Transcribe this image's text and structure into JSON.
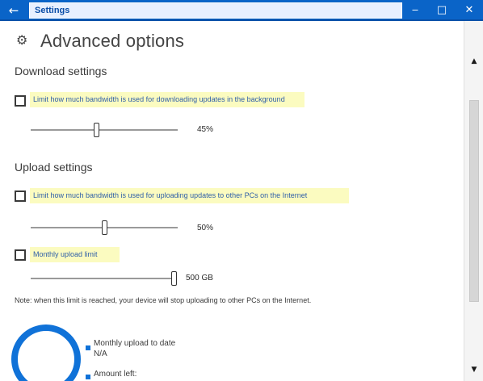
{
  "window": {
    "title": "Settings",
    "back_glyph": "←",
    "minimize_glyph": "‒",
    "maximize_glyph": "□",
    "close_glyph": "✕"
  },
  "page": {
    "title": "Advanced options",
    "icon": "gear-icon"
  },
  "download": {
    "heading": "Download settings",
    "limit_label": "Limit how much bandwidth is used for downloading updates in the background",
    "limit_checked": false,
    "slider_percent": 45,
    "slider_value": "45%"
  },
  "upload": {
    "heading": "Upload settings",
    "limit_label": "Limit how much bandwidth is used for uploading updates to other PCs on the Internet",
    "limit_checked": false,
    "slider_percent": 50,
    "slider_value": "50%",
    "monthly_label": "Monthly upload limit",
    "monthly_checked": false,
    "monthly_slider_value": "500 GB",
    "note": "Note: when this limit is reached, your device will stop uploading to other PCs on the Internet."
  },
  "stats": {
    "upload_to_date_label": "Monthly upload to date",
    "upload_to_date_value": "N/A",
    "amount_left_label": "Amount left:"
  },
  "colors": {
    "title_bar": "#0a64c8",
    "accent": "#1072d8",
    "highlight": "#fbfbc0",
    "link_text": "#2f5fa8"
  }
}
